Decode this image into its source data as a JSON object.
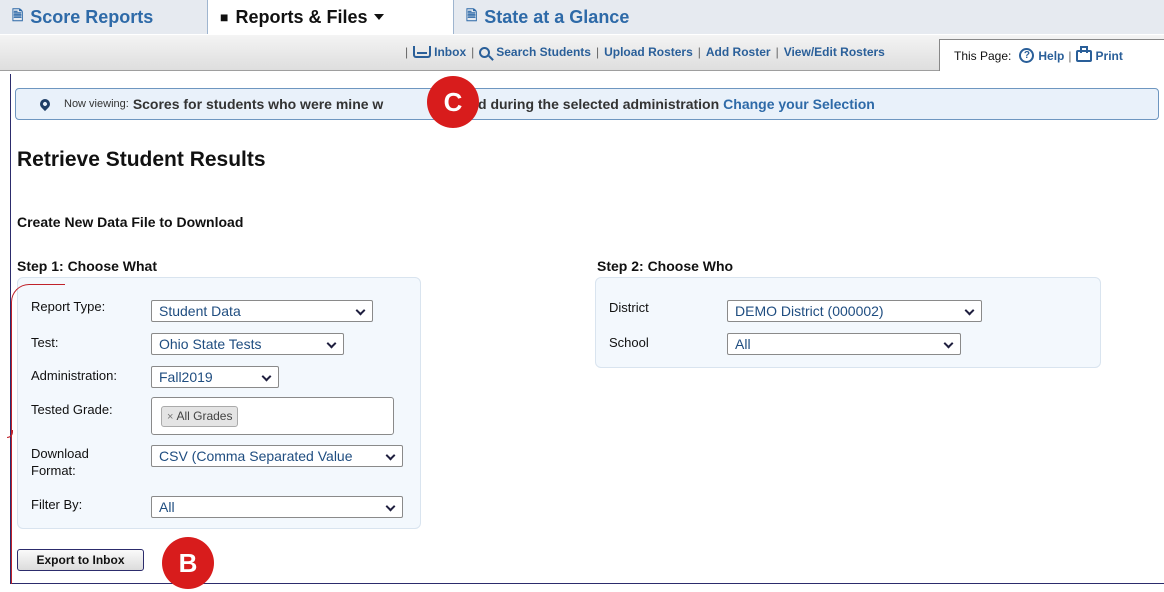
{
  "tabs": {
    "score_reports": "Score Reports",
    "reports_files": "Reports & Files",
    "state_glance": "State at a Glance"
  },
  "toolbar": {
    "inbox": "Inbox",
    "search_students": "Search Students",
    "upload_rosters": "Upload Rosters",
    "add_roster": "Add Roster",
    "view_edit_rosters": "View/Edit Rosters",
    "separator": "|",
    "this_page_label": "This Page:",
    "help": "Help",
    "print": "Print"
  },
  "viewing": {
    "prefix": "Now viewing:",
    "description": "Scores for students who were mine w",
    "description_tail": "tested during the selected administration",
    "change_link": "Change your Selection"
  },
  "page": {
    "title": "Retrieve Student Results",
    "section_title": "Create New Data File to Download"
  },
  "step1": {
    "title": "Step 1: Choose What",
    "report_type_label": "Report Type:",
    "report_type_value": "Student Data",
    "test_label": "Test:",
    "test_value": "Ohio State Tests",
    "administration_label": "Administration:",
    "administration_value": "Fall2019",
    "tested_grade_label": "Tested Grade:",
    "tested_grade_chip": "All Grades",
    "chip_remove": "×",
    "download_format_label_1": "Download",
    "download_format_label_2": "Format:",
    "download_format_value": "CSV (Comma Separated Value",
    "filter_by_label": "Filter By:",
    "filter_by_value": "All"
  },
  "step2": {
    "title": "Step 2: Choose Who",
    "district_label": "District",
    "district_value": "DEMO District (000002)",
    "school_label": "School",
    "school_value": "All"
  },
  "actions": {
    "export_label": "Export to Inbox"
  },
  "callouts": {
    "c": "C",
    "b": "B"
  },
  "colors": {
    "link_blue": "#2a5f99",
    "tab_blue": "#2e6aa8",
    "callout_red": "#d81c1c",
    "panel_bg": "#f3f8fd",
    "viewing_bg": "#e9f1fa"
  }
}
